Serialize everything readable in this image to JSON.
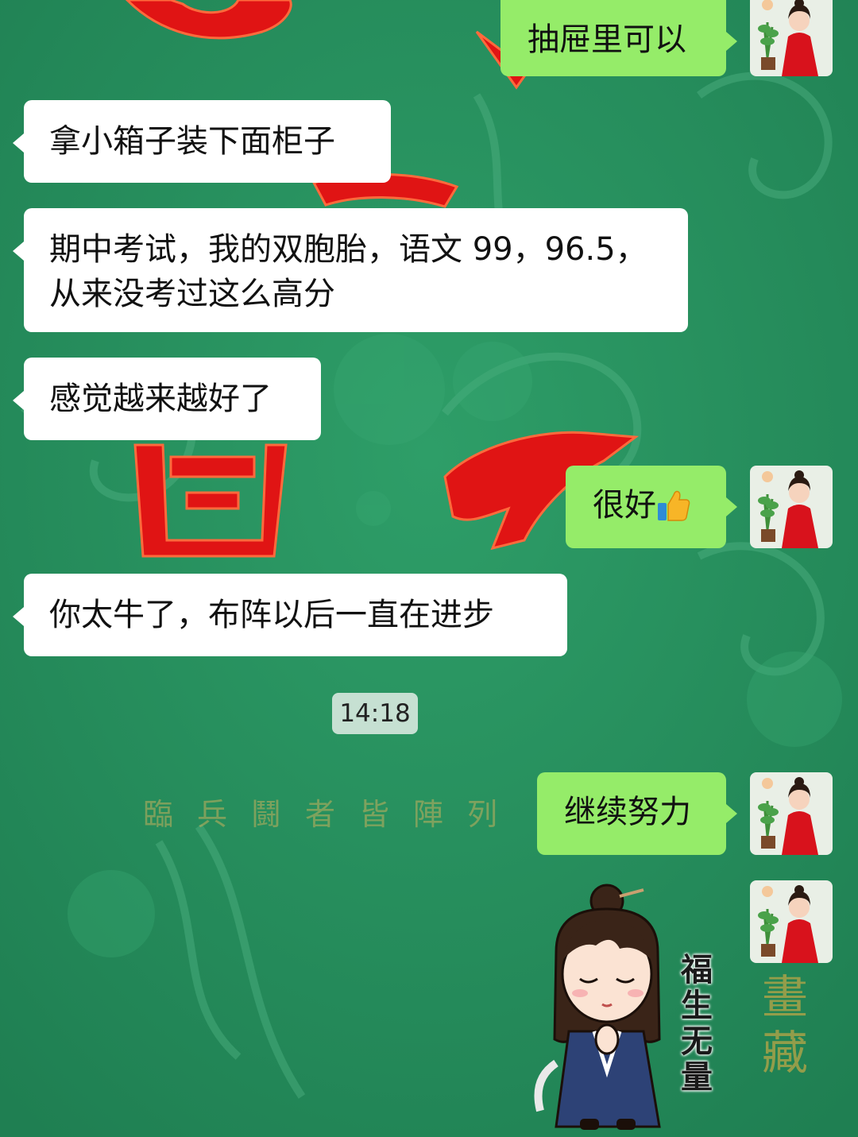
{
  "chat": {
    "messages": [
      {
        "side": "out",
        "text": "抽屉里可以"
      },
      {
        "side": "in",
        "text": "拿小箱子装下面柜子"
      },
      {
        "side": "in",
        "line1": "期中考试，我的双胞胎，语文 99，96.5，",
        "line2": "从来没考过这么高分"
      },
      {
        "side": "in",
        "text": "感觉越来越好了"
      },
      {
        "side": "out",
        "text": "很好",
        "emoji": "thumbs-up-icon"
      },
      {
        "side": "in",
        "text": "你太牛了，布阵以后一直在进步"
      },
      {
        "side": "out",
        "text": "继续努力"
      }
    ],
    "timestamp": "14:18",
    "sticker": {
      "caption": "福生无量",
      "icon": "cartoon-girl-praying-sticker"
    }
  },
  "background": {
    "title": "臨兵鬪者皆陣列",
    "vertical": "畫藏"
  },
  "colors": {
    "background": "#27925f",
    "outgoing_bubble": "#95ec69",
    "incoming_bubble": "#ffffff",
    "decor_red": "#e01414"
  }
}
